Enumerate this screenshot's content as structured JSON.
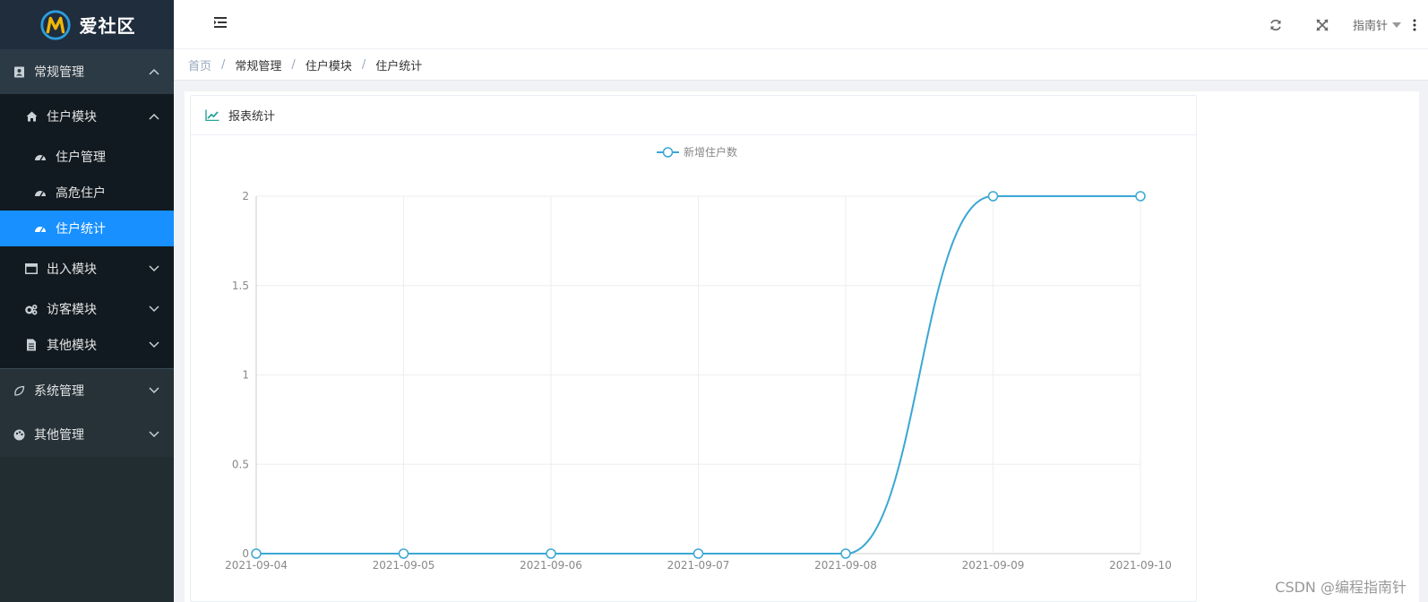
{
  "app": {
    "logo_text": "爱社区"
  },
  "sidebar": {
    "groups": [
      {
        "label": "常规管理",
        "icon": "contacts-book-icon",
        "expanded": true
      },
      {
        "label": "系统管理",
        "icon": "leaf-icon",
        "expanded": false
      },
      {
        "label": "其他管理",
        "icon": "palette-icon",
        "expanded": false
      }
    ],
    "modules": [
      {
        "label": "住户模块",
        "icon": "home-icon",
        "expanded": true
      },
      {
        "label": "出入模块",
        "icon": "window-icon",
        "expanded": false
      },
      {
        "label": "访客模块",
        "icon": "gears-icon",
        "expanded": false
      },
      {
        "label": "其他模块",
        "icon": "file-icon",
        "expanded": false
      }
    ],
    "items": [
      {
        "label": "住户管理",
        "icon": "dashboard-icon",
        "active": false
      },
      {
        "label": "高危住户",
        "icon": "dashboard-icon",
        "active": false
      },
      {
        "label": "住户统计",
        "icon": "dashboard-icon",
        "active": true
      }
    ]
  },
  "header": {
    "user_name": "指南针"
  },
  "breadcrumb": [
    "首页",
    "常规管理",
    "住户模块",
    "住户统计"
  ],
  "panel": {
    "title": "报表统计",
    "icon": "line-chart-icon"
  },
  "chart_data": {
    "type": "line",
    "legend": [
      "新增住户数"
    ],
    "legend_position": "top-center",
    "x": [
      "2021-09-04",
      "2021-09-05",
      "2021-09-06",
      "2021-09-07",
      "2021-09-08",
      "2021-09-09",
      "2021-09-10"
    ],
    "series": [
      {
        "name": "新增住户数",
        "values": [
          0,
          0,
          0,
          0,
          0,
          2,
          2
        ],
        "color": "#3ba7d4",
        "smooth": true
      }
    ],
    "ylim": [
      0,
      2
    ],
    "yticks": [
      0,
      0.5,
      1,
      1.5,
      2
    ],
    "grid": true
  },
  "watermark": "CSDN @编程指南针"
}
